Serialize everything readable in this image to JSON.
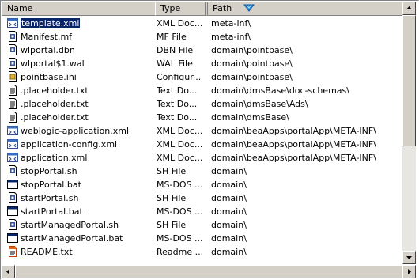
{
  "columns": {
    "name": "Name",
    "type": "Type",
    "path": "Path"
  },
  "files": [
    {
      "name": "template.xml",
      "type": "XML Doc...",
      "path": "meta-inf\\",
      "icon": "xml-file-icon",
      "selected": true
    },
    {
      "name": "Manifest.mf",
      "type": "MF File",
      "path": "meta-inf\\",
      "icon": "generic-file-icon"
    },
    {
      "name": "wlportal.dbn",
      "type": "DBN File",
      "path": "domain\\pointbase\\",
      "icon": "generic-file-icon"
    },
    {
      "name": "wlportal$1.wal",
      "type": "WAL File",
      "path": "domain\\pointbase\\",
      "icon": "generic-file-icon"
    },
    {
      "name": "pointbase.ini",
      "type": "Configur...",
      "path": "domain\\pointbase\\",
      "icon": "config-file-icon"
    },
    {
      "name": ".placeholder.txt",
      "type": "Text Do...",
      "path": "domain\\dmsBase\\doc-schemas\\",
      "icon": "text-file-icon"
    },
    {
      "name": ".placeholder.txt",
      "type": "Text Do...",
      "path": "domain\\dmsBase\\Ads\\",
      "icon": "text-file-icon"
    },
    {
      "name": ".placeholder.txt",
      "type": "Text Do...",
      "path": "domain\\dmsBase\\",
      "icon": "text-file-icon"
    },
    {
      "name": "weblogic-application.xml",
      "type": "XML Doc...",
      "path": "domain\\beaApps\\portalApp\\META-INF\\",
      "icon": "xml-file-icon"
    },
    {
      "name": "application-config.xml",
      "type": "XML Doc...",
      "path": "domain\\beaApps\\portalApp\\META-INF\\",
      "icon": "xml-file-icon"
    },
    {
      "name": "application.xml",
      "type": "XML Doc...",
      "path": "domain\\beaApps\\portalApp\\META-INF\\",
      "icon": "xml-file-icon"
    },
    {
      "name": "stopPortal.sh",
      "type": "SH File",
      "path": "domain\\",
      "icon": "generic-file-icon"
    },
    {
      "name": "stopPortal.bat",
      "type": "MS-DOS ...",
      "path": "domain\\",
      "icon": "batch-file-icon"
    },
    {
      "name": "startPortal.sh",
      "type": "SH File",
      "path": "domain\\",
      "icon": "generic-file-icon"
    },
    {
      "name": "startPortal.bat",
      "type": "MS-DOS ...",
      "path": "domain\\",
      "icon": "batch-file-icon"
    },
    {
      "name": "startManagedPortal.sh",
      "type": "SH File",
      "path": "domain\\",
      "icon": "generic-file-icon"
    },
    {
      "name": "startManagedPortal.bat",
      "type": "MS-DOS ...",
      "path": "domain\\",
      "icon": "batch-file-icon"
    },
    {
      "name": "README.txt",
      "type": "Readme ...",
      "path": "domain\\",
      "icon": "readme-file-icon"
    }
  ],
  "colors": {
    "selection": "#0a246a",
    "face": "#d4d0c8"
  }
}
